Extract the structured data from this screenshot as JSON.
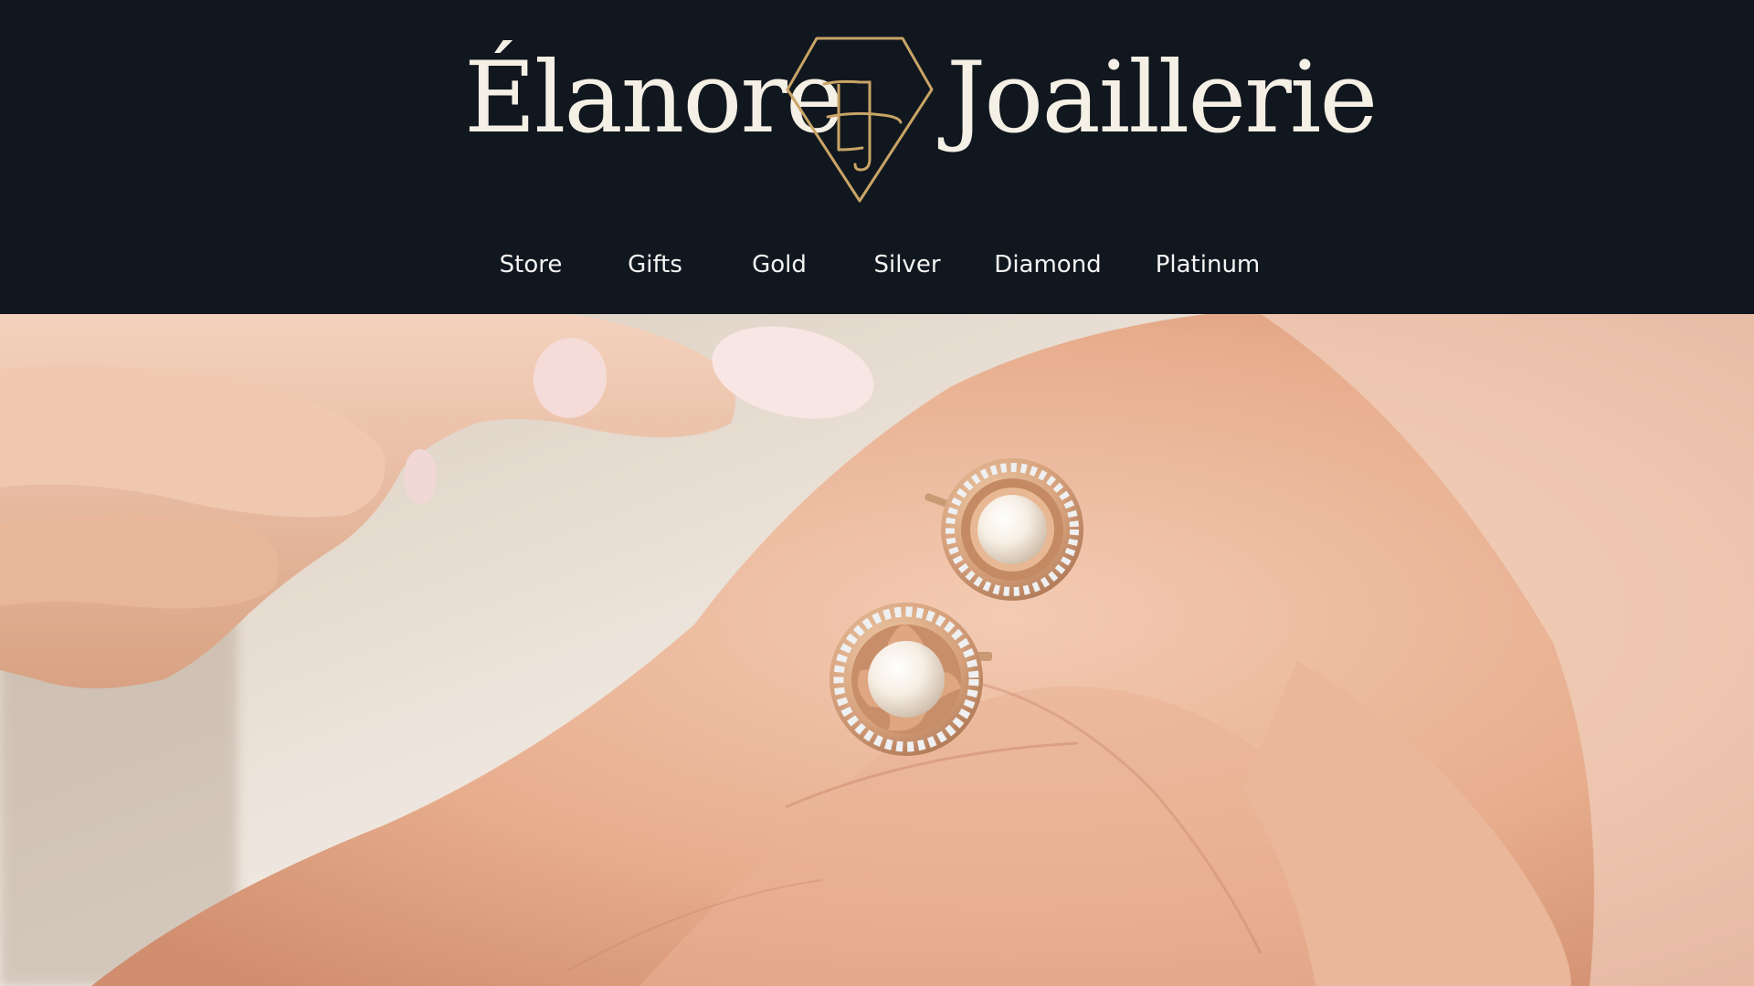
{
  "brand": {
    "name_left": "Élanore",
    "name_right": "Joaillerie",
    "monogram": "EJ",
    "logo_icon": "diamond-monogram-icon",
    "text_color": "#f5f0e6",
    "accent_color": "#c9a467"
  },
  "header": {
    "background_color": "#11171e"
  },
  "nav": {
    "items": [
      {
        "label": "Store"
      },
      {
        "label": "Gifts"
      },
      {
        "label": "Gold"
      },
      {
        "label": "Silver"
      },
      {
        "label": "Diamond"
      },
      {
        "label": "Platinum"
      }
    ]
  },
  "hero": {
    "image_subject": "pearl-earrings-in-hand-image"
  }
}
